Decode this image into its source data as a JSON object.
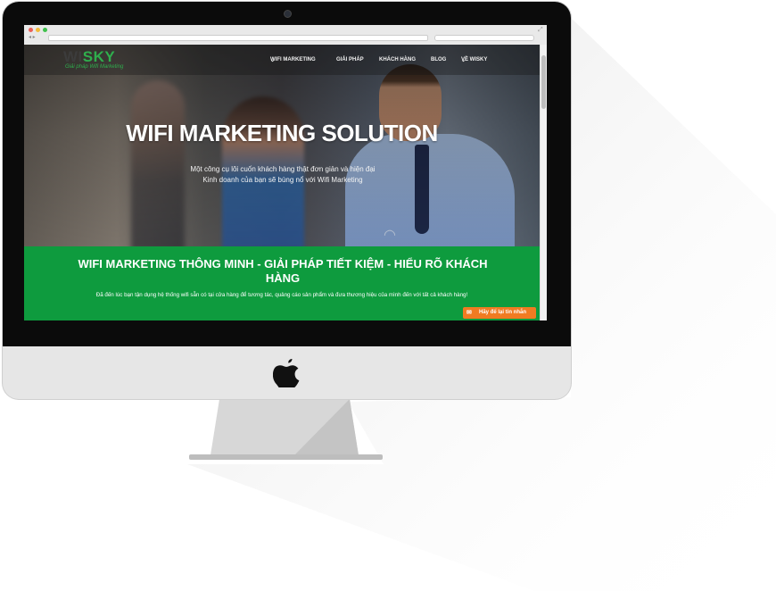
{
  "colors": {
    "accent_green": "#0e9b3e",
    "logo_green": "#2fae4d",
    "button_orange": "#f07b22"
  },
  "browser": {
    "url": "",
    "search": ""
  },
  "site": {
    "logo_part1": "WI",
    "logo_part2": "SKY",
    "logo_tagline": "Giải pháp Wifi Marketing",
    "menu": [
      {
        "label": "WIFI MARKETING",
        "caret": "⌄"
      },
      {
        "label": "GIẢI PHÁP"
      },
      {
        "label": "KHÁCH HÀNG"
      },
      {
        "label": "BLOG"
      },
      {
        "label": "VỀ WISKY",
        "caret": "⌄"
      }
    ]
  },
  "hero": {
    "title": "WIFI MARKETING SOLUTION",
    "subtitle_line1": "Một công cụ lôi cuốn khách hàng thật đơn giản và hiện đại",
    "subtitle_line2": "Kinh doanh của bạn sẽ bùng nổ với Wifi Marketing"
  },
  "band": {
    "title": "WIFI MARKETING THÔNG MINH - GIẢI PHÁP TIẾT KIỆM - HIỂU RÕ KHÁCH HÀNG",
    "text": "Đã đến lúc bạn tận dụng hệ thống wifi sẵn có tại cửa hàng để tương tác, quảng cáo sản phẩm và đưa thương hiệu của mình đến với tất cả khách hàng!"
  },
  "message_button": {
    "label": "Hãy để lại tin nhắn",
    "icon": "envelope-icon"
  }
}
